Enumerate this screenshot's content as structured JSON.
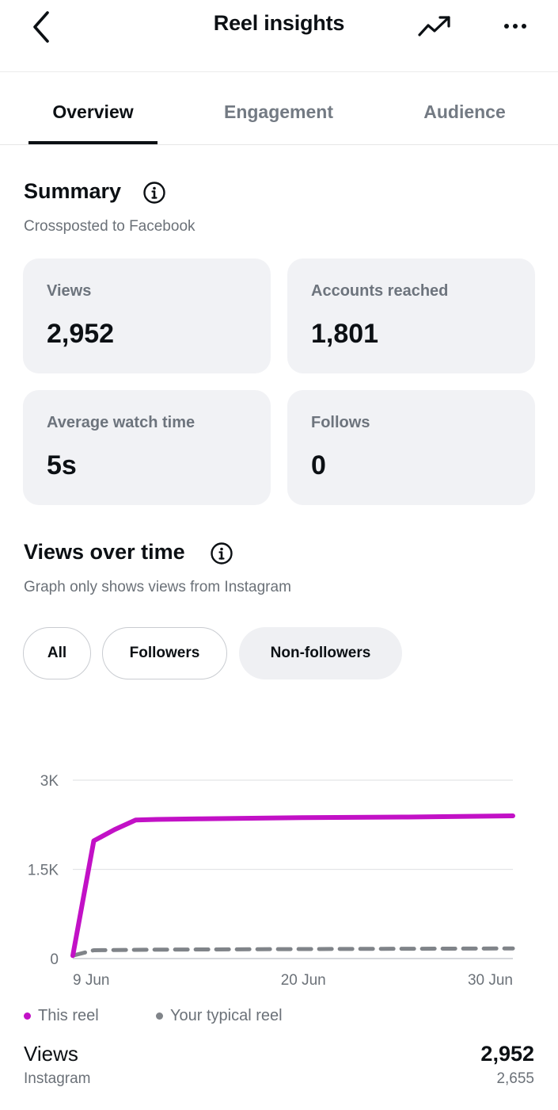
{
  "header": {
    "title": "Reel insights",
    "back_icon": "chevron-left-icon",
    "trend_icon": "trending-up-icon",
    "more_icon": "more-horizontal-icon"
  },
  "tabs": [
    {
      "label": "Overview",
      "active": true
    },
    {
      "label": "Engagement",
      "active": false
    },
    {
      "label": "Audience",
      "active": false
    }
  ],
  "summary": {
    "title": "Summary",
    "subtitle": "Crossposted to Facebook",
    "cards": [
      {
        "label": "Views",
        "value": "2,952"
      },
      {
        "label": "Accounts reached",
        "value": "1,801"
      },
      {
        "label": "Average watch time",
        "value": "5s"
      },
      {
        "label": "Follows",
        "value": "0"
      }
    ]
  },
  "views_over_time": {
    "title": "Views over time",
    "subtitle": "Graph only shows views from Instagram",
    "filters": [
      {
        "label": "All",
        "selected": false
      },
      {
        "label": "Followers",
        "selected": false
      },
      {
        "label": "Non-followers",
        "selected": true
      }
    ]
  },
  "colors": {
    "this_reel": "#c211c6",
    "typical_reel": "#808489",
    "card_bg": "#f1f2f5"
  },
  "chart_data": {
    "type": "line",
    "y_tick_labels": [
      "0",
      "1.5K",
      "3K"
    ],
    "y_ticks": [
      0,
      1500,
      3000
    ],
    "ylim": [
      0,
      3000
    ],
    "x_tick_labels": [
      "9 Jun",
      "20 Jun",
      "30 Jun"
    ],
    "x_ticks": [
      "2024-06-09",
      "2024-06-20",
      "2024-06-30"
    ],
    "xlim": [
      "2024-06-09",
      "2024-06-30"
    ],
    "grid": true,
    "legend_position": "bottom-left",
    "series": [
      {
        "name": "This reel",
        "style": "solid",
        "x": [
          "2024-06-09",
          "2024-06-10",
          "2024-06-11",
          "2024-06-12",
          "2024-06-13",
          "2024-06-15",
          "2024-06-20",
          "2024-06-25",
          "2024-06-30"
        ],
        "values": [
          50,
          1980,
          2170,
          2330,
          2340,
          2350,
          2370,
          2380,
          2400
        ]
      },
      {
        "name": "Your typical reel",
        "style": "dashed",
        "x": [
          "2024-06-09",
          "2024-06-10",
          "2024-06-13",
          "2024-06-20",
          "2024-06-30"
        ],
        "values": [
          50,
          140,
          150,
          160,
          170
        ]
      }
    ]
  },
  "footer": {
    "views_label": "Views",
    "views_source": "Instagram",
    "views_total": "2,952",
    "views_instagram": "2,655"
  }
}
